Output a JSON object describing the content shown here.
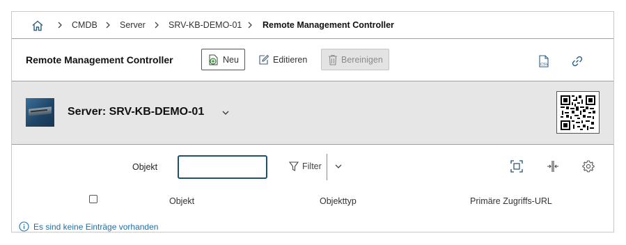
{
  "breadcrumb": {
    "items": [
      {
        "label": "CMDB"
      },
      {
        "label": "Server"
      },
      {
        "label": "SRV-KB-DEMO-01"
      },
      {
        "label": "Remote Management Controller"
      }
    ]
  },
  "toolbar": {
    "title": "Remote Management Controller",
    "new_label": "Neu",
    "edit_label": "Editieren",
    "purge_label": "Bereinigen",
    "csv_icon": "csv-export-icon",
    "link_icon": "link-icon"
  },
  "object": {
    "title": "Server: SRV-KB-DEMO-01",
    "image_icon": "server-icon",
    "qr_icon": "qr-code-icon"
  },
  "filter": {
    "label": "Objekt",
    "value": "",
    "button_label": "Filter"
  },
  "table": {
    "columns": [
      "Objekt",
      "Objekttyp",
      "Primäre Zugriffs-URL"
    ],
    "empty_message": "Es sind keine Einträge vorhanden"
  },
  "colors": {
    "accent": "#1e4f6b",
    "info": "#1f6fa6",
    "header_bg": "#e6e6e6",
    "disabled_bg": "#e3e3e3"
  }
}
